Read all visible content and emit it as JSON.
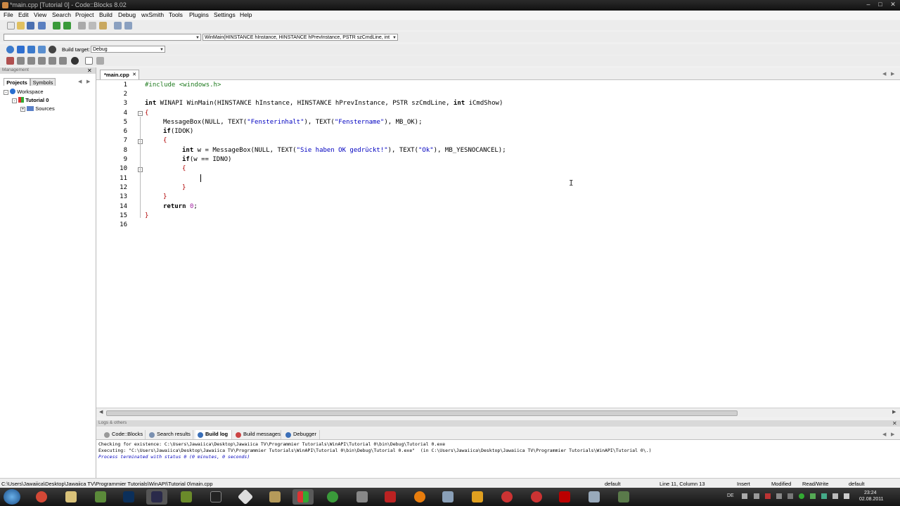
{
  "window": {
    "title": "*main.cpp [Tutorial 0] - Code::Blocks 8.02",
    "controls": [
      "minimize-icon",
      "maximize-icon",
      "close-icon"
    ]
  },
  "menu": [
    "File",
    "Edit",
    "View",
    "Search",
    "Project",
    "Build",
    "Debug",
    "wxSmith",
    "Tools",
    "Plugins",
    "Settings",
    "Help"
  ],
  "toolbar": {
    "scope_value": "",
    "function_value": "WinMain(HINSTANCE hInstance, HINSTANCE hPrevInstance, PSTR szCmdLine, int",
    "build_target_label": "Build target:",
    "build_target_value": "Debug"
  },
  "management": {
    "header": "Management",
    "tabs": [
      "Projects",
      "Symbols"
    ],
    "tree": {
      "workspace": "Workspace",
      "project": "Tutorial 0",
      "folder": "Sources"
    }
  },
  "editor": {
    "tab_label": "*main.cpp",
    "line_numbers": [
      "1",
      "2",
      "3",
      "4",
      "5",
      "6",
      "7",
      "8",
      "9",
      "10",
      "11",
      "12",
      "13",
      "14",
      "15",
      "16"
    ],
    "code": {
      "l1": "#include <windows.h>",
      "l3_kw": "int",
      "l3_rest": " WINAPI WinMain(HINSTANCE hInstance, HINSTANCE hPrevInstance, PSTR szCmdLine, ",
      "l3_kw2": "int",
      "l3_end": " iCmdShow)",
      "l4": "{",
      "l5_a": "MessageBox(NULL, TEXT(",
      "l5_s1": "\"Fensterinhalt\"",
      "l5_b": "), TEXT(",
      "l5_s2": "\"Fenstername\"",
      "l5_c": "), MB_OK);",
      "l6_kw": "if",
      "l6_rest": "(IDOK)",
      "l7": "{",
      "l8_kw": "int",
      "l8_a": " w = MessageBox(NULL, TEXT(",
      "l8_s1": "\"Sie haben OK gedrückt!\"",
      "l8_b": "), TEXT(",
      "l8_s2": "\"Ok\"",
      "l8_c": "), MB_YESNOCANCEL);",
      "l9_kw": "if",
      "l9_rest": "(w == IDNO)",
      "l10": "{",
      "l12": "}",
      "l13": "}",
      "l14_kw": "return",
      "l14_num": "0",
      "l14_end": ";",
      "l15": "}"
    }
  },
  "logs": {
    "header": "Logs & others",
    "tabs": [
      "Code::Blocks",
      "Search results",
      "Build log",
      "Build messages",
      "Debugger"
    ],
    "lines": [
      "Checking for existence: C:\\Users\\Jawaiica\\Desktop\\Jawaiica TV\\Programmier Tutorials\\WinAPI\\Tutorial 0\\bin\\Debug\\Tutorial 0.exe",
      "Executing: \"C:\\Users\\Jawaiica\\Desktop\\Jawaiica TV\\Programmier Tutorials\\WinAPI\\Tutorial 0\\bin\\Debug\\Tutorial 0.exe\"  (in C:\\Users\\Jawaiica\\Desktop\\Jawaiica TV\\Programmier Tutorials\\WinAPI\\Tutorial 0\\.)",
      "Process terminated with status 0 (0 minutes, 0 seconds)"
    ]
  },
  "status": {
    "path": "C:\\Users\\Jawaiica\\Desktop\\Jawaiica TV\\Programmier Tutorials\\WinAPI\\Tutorial 0\\main.cpp",
    "encoding": "default",
    "position": "Line 11, Column 13",
    "mode": "Insert",
    "modified": "Modified",
    "access": "Read/Write",
    "lang": "default"
  },
  "taskbar": {
    "locale": "DE",
    "time": "23:24",
    "date": "02.08.2011",
    "apps": [
      "chrome-icon",
      "explorer-icon",
      "minecraft-icon",
      "photoshop-icon",
      "after-effects-icon",
      "notepad-icon",
      "console-icon",
      "wizard-icon",
      "archive-icon",
      "codeblocks-icon",
      "greenshot-icon",
      "steam-icon",
      "filezilla-icon",
      "blender-icon",
      "settings-icon",
      "security-icon",
      "media-icon",
      "acrobat-icon",
      "vmware-icon",
      "misc-icon"
    ]
  },
  "colors": {
    "preprocessor": "#1e7a1e",
    "string": "#0000c0",
    "number": "#a020a0",
    "brace": "#b00000"
  }
}
